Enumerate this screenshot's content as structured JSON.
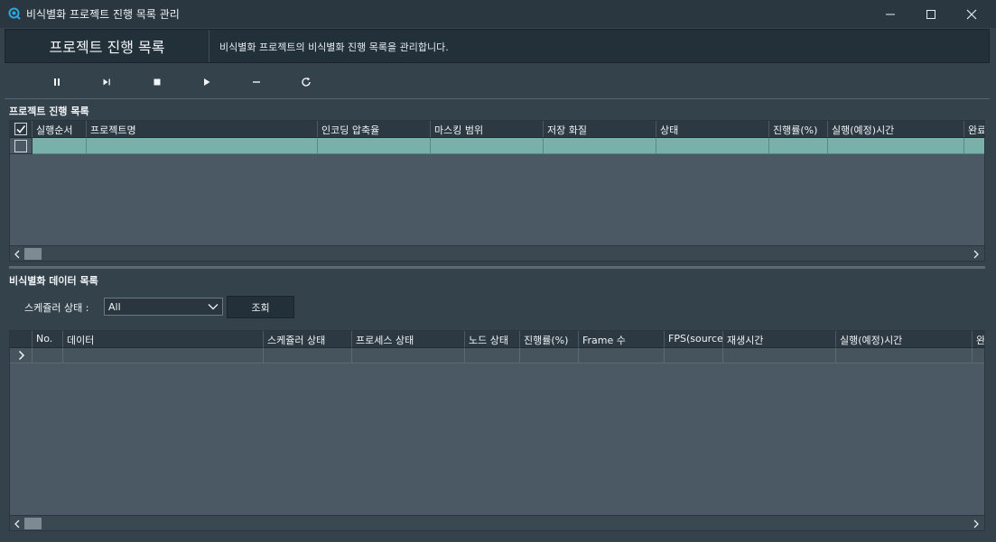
{
  "window": {
    "title": "비식별화 프로젝트 진행 목록 관리",
    "controls": {
      "minimize": "minimize-icon",
      "maximize": "maximize-icon",
      "close": "close-icon"
    }
  },
  "header": {
    "title": "프로젝트 진행 목록",
    "description": "비식별화 프로젝트의 비식별화 진행 목록을 관리합니다."
  },
  "toolbar": {
    "buttons": [
      {
        "icon": "pause-icon"
      },
      {
        "icon": "step-forward-icon"
      },
      {
        "icon": "stop-icon"
      },
      {
        "icon": "play-icon"
      },
      {
        "icon": "minus-icon"
      },
      {
        "icon": "refresh-icon"
      }
    ]
  },
  "project_grid": {
    "label": "프로젝트 진행  목록",
    "columns": [
      "실행순서",
      "프로젝트명",
      "인코딩 압축율",
      "마스킹 범위",
      "저장 화질",
      "상태",
      "진행률(%)",
      "실행(예정)시간",
      "완료"
    ],
    "header_checkbox_checked": true,
    "rows": [
      {
        "checked": false,
        "cells": [
          "",
          "",
          "",
          "",
          "",
          "",
          "",
          "",
          ""
        ]
      }
    ]
  },
  "data_grid": {
    "label": "비식별화 데이터 목록",
    "columns": [
      "No.",
      "데이터",
      "스케쥴러 상태",
      "프로세스 상태",
      "노드 상태",
      "진행률(%)",
      "Frame 수",
      "FPS(source)",
      "재생시간",
      "실행(예정)시간",
      "완"
    ],
    "rows": [
      {
        "cells": [
          "",
          "",
          "",
          "",
          "",
          "",
          "",
          "",
          "",
          "",
          ""
        ]
      }
    ]
  },
  "filter": {
    "label": "스케쥴러 상태 :",
    "selected": "All",
    "button_label": "조회"
  },
  "colors": {
    "background": "#34424c",
    "panel_dark": "#22303a",
    "grid_body": "#4a5963",
    "selected_row": "#7ab0aa"
  }
}
